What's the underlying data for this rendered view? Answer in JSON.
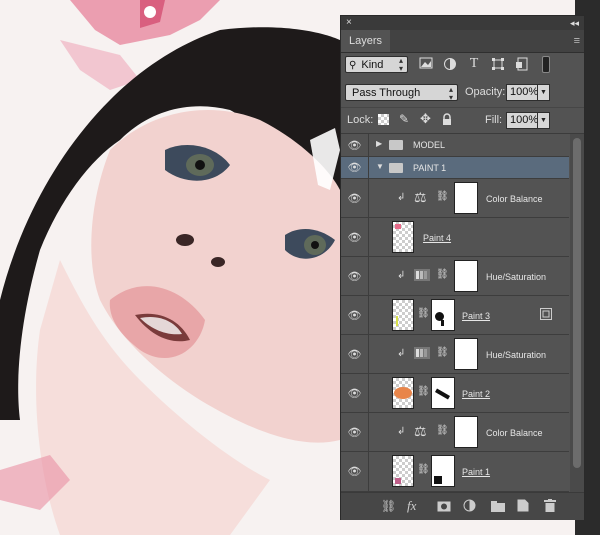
{
  "panel": {
    "tab_label": "Layers",
    "close_glyph": "×",
    "collapse_glyph": "◂◂",
    "menu_glyph": "≡",
    "filter": {
      "kind_label": "Kind",
      "icons": [
        "pixel-filter-icon",
        "adjustment-filter-icon",
        "type-filter-icon",
        "shape-filter-icon",
        "smart-object-filter-icon"
      ]
    },
    "blend_mode": "Pass Through",
    "opacity_label": "Opacity:",
    "opacity_value": "100%",
    "lock_label": "Lock:",
    "fill_label": "Fill:",
    "fill_value": "100%"
  },
  "layers": [
    {
      "name": "MODEL",
      "type": "group",
      "expanded": false,
      "selected": false
    },
    {
      "name": "PAINT 1",
      "type": "group",
      "expanded": true,
      "selected": true
    },
    {
      "name": "Color Balance",
      "type": "adjustment",
      "adjustment": "color-balance",
      "clipped": true
    },
    {
      "name": "Paint 4",
      "type": "pixel",
      "clipped": false
    },
    {
      "name": "Hue/Saturation",
      "type": "adjustment",
      "adjustment": "hue-saturation",
      "clipped": true
    },
    {
      "name": "Paint 3",
      "type": "pixel-mask",
      "smart_badge": true
    },
    {
      "name": "Hue/Saturation",
      "type": "adjustment",
      "adjustment": "hue-saturation",
      "clipped": true
    },
    {
      "name": "Paint 2",
      "type": "pixel-mask"
    },
    {
      "name": "Color Balance",
      "type": "adjustment",
      "adjustment": "color-balance",
      "clipped": true
    },
    {
      "name": "Paint 1",
      "type": "pixel-mask"
    }
  ],
  "bottom_bar": {
    "fx_label": "fx",
    "icons": [
      "link-layers-icon",
      "fx-icon",
      "add-mask-icon",
      "new-adjustment-icon",
      "new-group-icon",
      "new-layer-icon",
      "trash-icon"
    ]
  },
  "colors": {
    "panel_bg": "#535353",
    "selected_row": "#5a6b7d",
    "paint_pink": "#e76b8a"
  }
}
